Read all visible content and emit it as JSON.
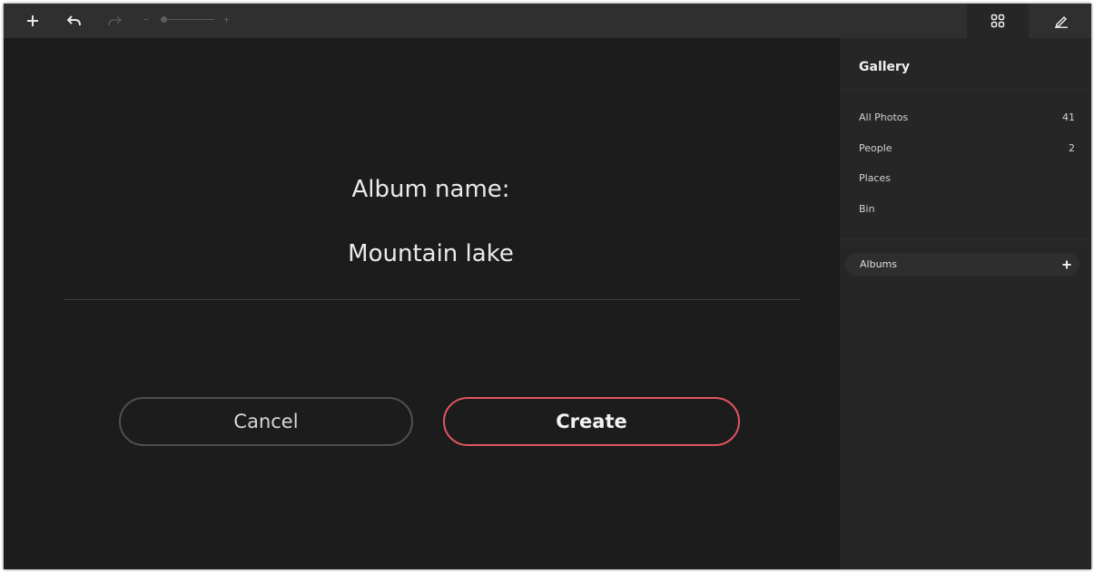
{
  "toolbar": {
    "icons": [
      "add-icon",
      "undo-icon",
      "redo-icon",
      "zoom-slider",
      "grid-view-icon",
      "edit-icon"
    ],
    "zoom_level": 0.0
  },
  "dialog": {
    "label": "Album name:",
    "value": "Mountain lake",
    "cancel_label": "Cancel",
    "create_label": "Create"
  },
  "sidebar": {
    "title": "Gallery",
    "items": [
      {
        "label": "All Photos",
        "count": "41"
      },
      {
        "label": "People",
        "count": "2"
      },
      {
        "label": "Places",
        "count": ""
      },
      {
        "label": "Bin",
        "count": ""
      }
    ],
    "albums_label": "Albums"
  },
  "colors": {
    "background": "#1c1c1c",
    "toolbar": "#2f2f2f",
    "sidebar": "#262626",
    "accent": "#e2555f"
  }
}
